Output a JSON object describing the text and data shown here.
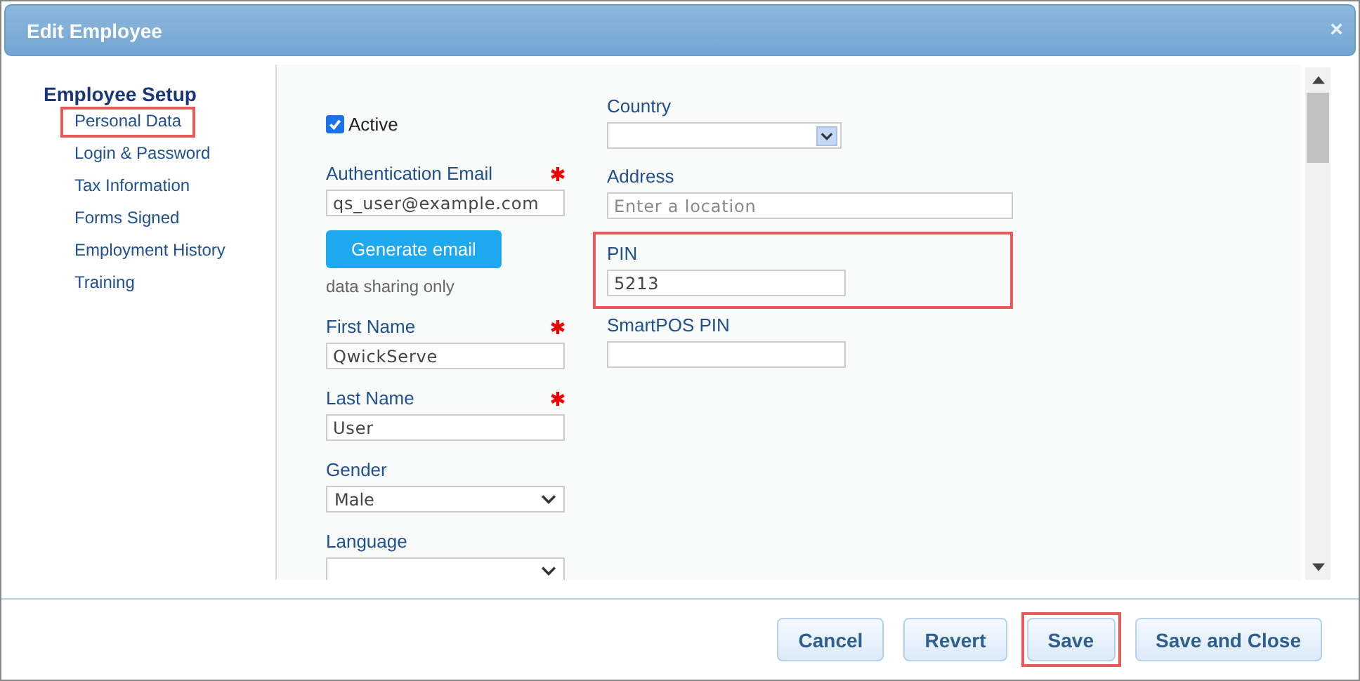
{
  "window": {
    "title": "Edit Employee",
    "close": "×"
  },
  "sidebar": {
    "title": "Employee Setup",
    "items": [
      {
        "label": "Personal Data",
        "highlighted": true
      },
      {
        "label": "Login & Password",
        "highlighted": false
      },
      {
        "label": "Tax Information",
        "highlighted": false
      },
      {
        "label": "Forms Signed",
        "highlighted": false
      },
      {
        "label": "Employment History",
        "highlighted": false
      },
      {
        "label": "Training",
        "highlighted": false
      }
    ]
  },
  "left_column": [
    {
      "kind": "checkbox",
      "label": "Active",
      "checked": true
    },
    {
      "kind": "text",
      "label": "Authentication Email",
      "required": true,
      "value": "qs_user@example.com"
    },
    {
      "kind": "button",
      "label": "Generate email"
    },
    {
      "kind": "note",
      "label": "data sharing only"
    },
    {
      "kind": "text",
      "label": "First Name",
      "required": true,
      "value": "QwickServe"
    },
    {
      "kind": "text",
      "label": "Last Name",
      "required": true,
      "value": "User"
    },
    {
      "kind": "select",
      "label": "Gender",
      "value": "Male"
    },
    {
      "kind": "select",
      "label": "Language"
    }
  ],
  "right_column": [
    {
      "kind": "combo",
      "label": "Country"
    },
    {
      "kind": "wide",
      "label": "Address",
      "placeholder": "Enter a location"
    },
    {
      "kind": "text",
      "label": "PIN",
      "value": "5213",
      "highlighted": true
    },
    {
      "kind": "text",
      "label": "SmartPOS PIN"
    }
  ],
  "buttons": [
    {
      "label": "Cancel",
      "highlighted": false
    },
    {
      "label": "Revert",
      "highlighted": false
    },
    {
      "label": "Save",
      "highlighted": true
    },
    {
      "label": "Save and Close",
      "highlighted": false
    }
  ]
}
